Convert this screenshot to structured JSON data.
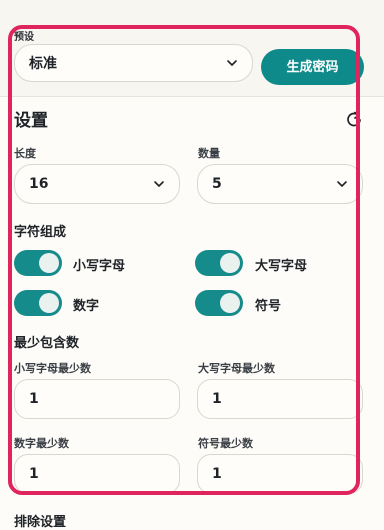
{
  "preset": {
    "label": "预设",
    "value": "标准",
    "generate_button": "生成密码"
  },
  "settings": {
    "title": "设置",
    "length": {
      "label": "长度",
      "value": "16"
    },
    "count": {
      "label": "数量",
      "value": "5"
    }
  },
  "charset": {
    "title": "字符组成",
    "lowercase": {
      "label": "小写字母",
      "enabled": true
    },
    "uppercase": {
      "label": "大写字母",
      "enabled": true
    },
    "digits": {
      "label": "数字",
      "enabled": true
    },
    "symbols": {
      "label": "符号",
      "enabled": true
    }
  },
  "minimums": {
    "title": "最少包含数",
    "lowercase": {
      "label": "小写字母最少数",
      "value": "1"
    },
    "uppercase": {
      "label": "大写字母最少数",
      "value": "1"
    },
    "digits": {
      "label": "数字最少数",
      "value": "1"
    },
    "symbols": {
      "label": "符号最少数",
      "value": "1"
    }
  },
  "exclude": {
    "title": "排除设置"
  },
  "colors": {
    "accent": "#0f8a8a",
    "highlight": "#e0245e",
    "toggle_on": "#168b8b"
  },
  "icons": {
    "select": "chevron-down-icon",
    "reset": "refresh-icon"
  }
}
